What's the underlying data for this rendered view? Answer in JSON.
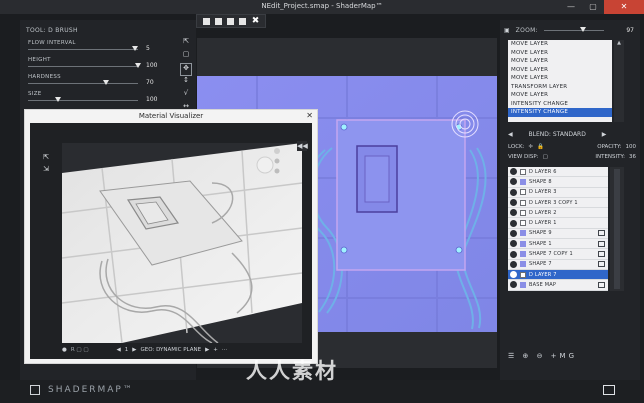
{
  "window": {
    "title": "NEdit_Project.smap - ShaderMap™",
    "min": "—",
    "max": "▢",
    "close": "✕"
  },
  "brush": {
    "tool_label": "TOOL: D BRUSH",
    "params": [
      {
        "name": "FLOW INTERVAL",
        "value": "5"
      },
      {
        "name": "HEIGHT",
        "value": "100"
      },
      {
        "name": "HARDNESS",
        "value": "70"
      },
      {
        "name": "SIZE",
        "value": "100"
      }
    ],
    "tools": [
      "⇱",
      "▢",
      "✥",
      "↕",
      "√",
      "↔"
    ]
  },
  "visualizer": {
    "title": "Material Visualizer",
    "close": "✕",
    "left_icons": [
      "⇱",
      "⇲"
    ],
    "bottom": {
      "labels": "R  ▢  ▢",
      "page": "1",
      "geo": "GEO: DYNAMIC PLANE",
      "prev": "◀",
      "next": "▶",
      "play": "▶",
      "add": "+",
      "more": "···"
    },
    "side_button": "◀◀"
  },
  "zoom": {
    "label": "ZOOM:",
    "value": "97"
  },
  "history": {
    "items": [
      "MOVE LAYER",
      "MOVE LAYER",
      "MOVE LAYER",
      "MOVE LAYER",
      "MOVE LAYER",
      "TRANSFORM LAYER",
      "MOVE LAYER",
      "INTENSITY CHANGE",
      "INTENSITY CHANGE"
    ],
    "selected_index": 8
  },
  "blend": {
    "label": "BLEND: STANDARD",
    "prev": "◀",
    "next": "▶"
  },
  "lock": {
    "label": "LOCK:",
    "opacity_label": "OPACITY:",
    "opacity_value": "100"
  },
  "view": {
    "label": "VIEW DISP:",
    "intensity_label": "INTENSITY:",
    "intensity_value": "36"
  },
  "layers": {
    "items": [
      {
        "name": "D LAYER 6",
        "swatch": "white"
      },
      {
        "name": "SHAPE 8",
        "swatch": "blue"
      },
      {
        "name": "D LAYER 3",
        "swatch": "white"
      },
      {
        "name": "D LAYER 3 COPY 1",
        "swatch": "white"
      },
      {
        "name": "D LAYER 2",
        "swatch": "white"
      },
      {
        "name": "D LAYER 1",
        "swatch": "white"
      },
      {
        "name": "SHAPE 9",
        "swatch": "blue",
        "badge": true
      },
      {
        "name": "SHAPE 1",
        "swatch": "blue",
        "badge": true
      },
      {
        "name": "SHAPE 7 COPY 1",
        "swatch": "blue",
        "badge": true
      },
      {
        "name": "SHAPE 7",
        "swatch": "blue",
        "badge": true
      },
      {
        "name": "D LAYER 7",
        "swatch": "white",
        "selected": true
      },
      {
        "name": "BASE MAP",
        "swatch": "blue",
        "badge": true
      }
    ]
  },
  "layer_tools": "☰ ⊕ ⊖ +MG",
  "status": {
    "brand": "SHADERMAP™"
  },
  "watermark": "人人素材",
  "colors": {
    "accent": "#2f66c9",
    "normal_map": "#8a8ee6",
    "background": "#1b1d20",
    "close": "#c84434"
  }
}
